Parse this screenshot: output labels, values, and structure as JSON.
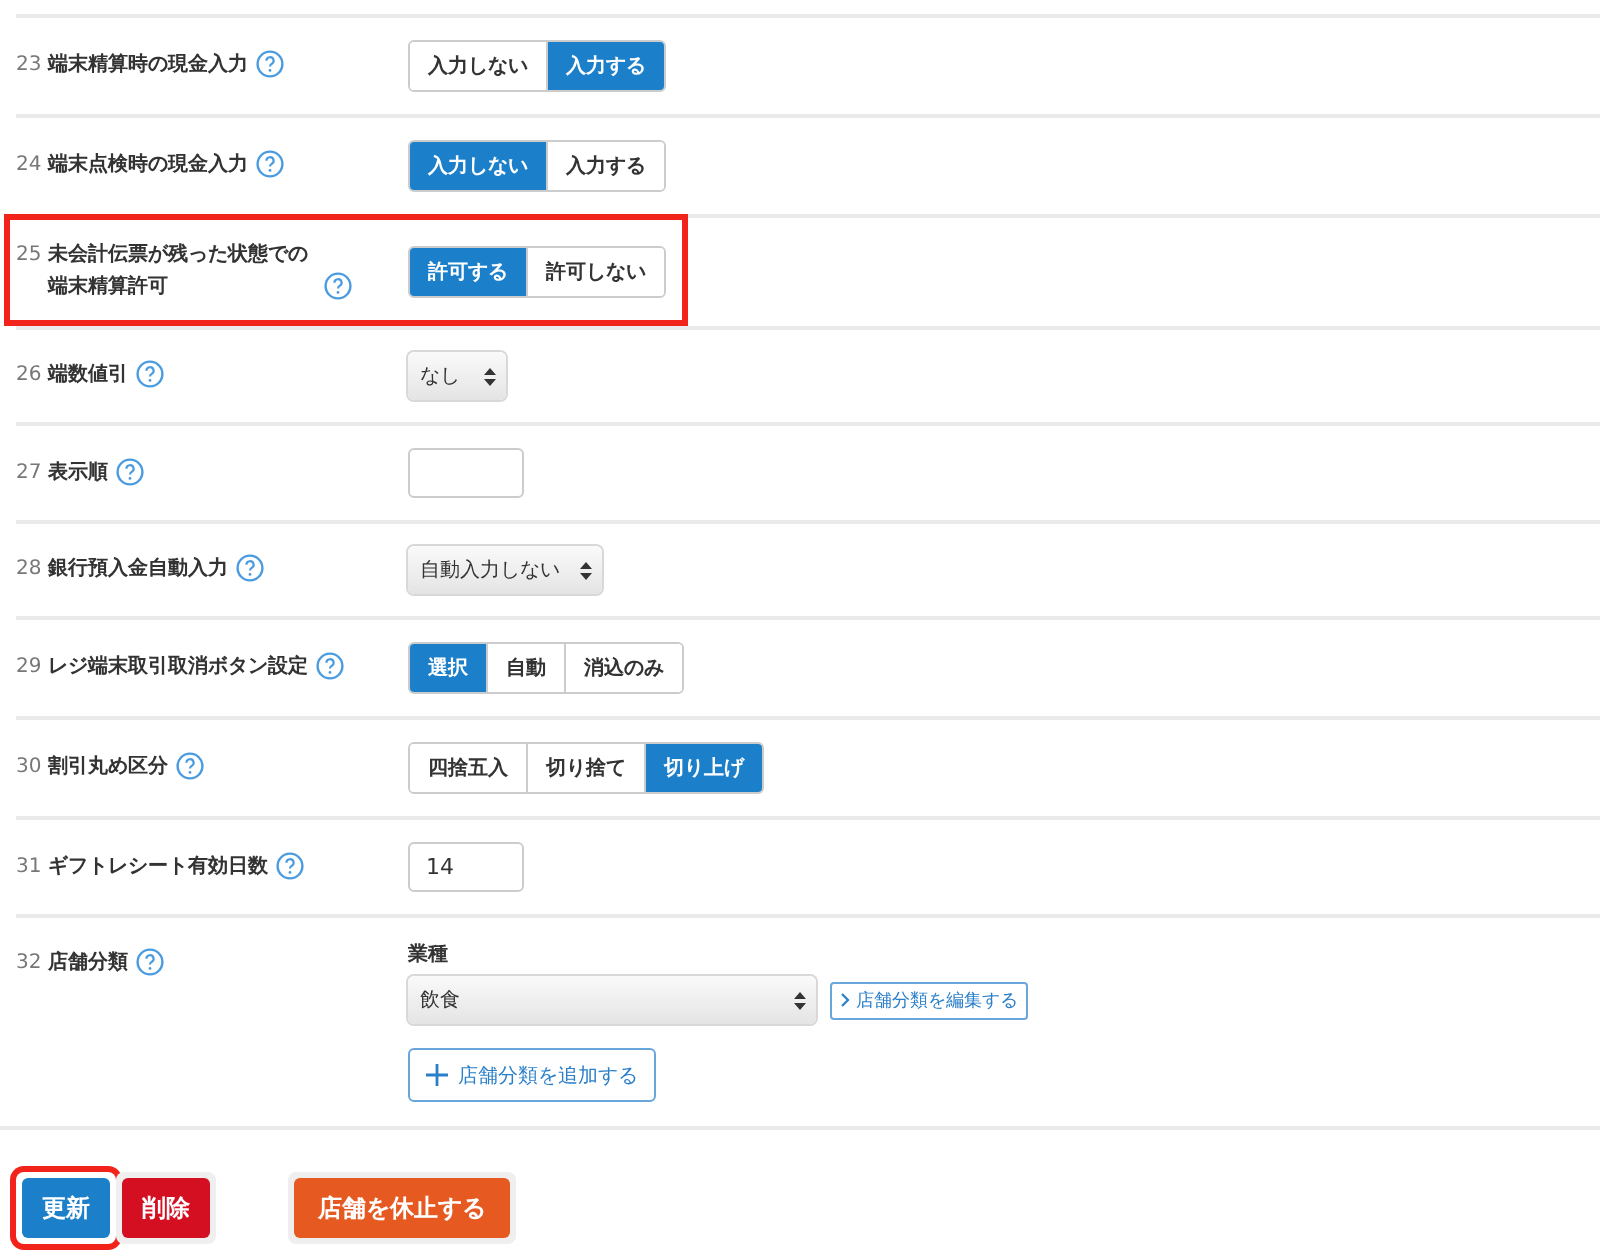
{
  "rows": [
    {
      "number": "23",
      "label": "端末精算時の現金入力",
      "kind": "toggle",
      "highlighted": false,
      "options": [
        {
          "label": "入力しない",
          "selected": false
        },
        {
          "label": "入力する",
          "selected": true
        }
      ]
    },
    {
      "number": "24",
      "label": "端末点検時の現金入力",
      "kind": "toggle",
      "highlighted": false,
      "options": [
        {
          "label": "入力しない",
          "selected": true
        },
        {
          "label": "入力する",
          "selected": false
        }
      ]
    },
    {
      "number": "25",
      "label": "未会計伝票が残った状態での端末精算許可",
      "kind": "toggle",
      "highlighted": true,
      "options": [
        {
          "label": "許可する",
          "selected": true
        },
        {
          "label": "許可しない",
          "selected": false
        }
      ]
    },
    {
      "number": "26",
      "label": "端数値引",
      "kind": "select",
      "highlighted": false,
      "value": "なし"
    },
    {
      "number": "27",
      "label": "表示順",
      "kind": "input",
      "highlighted": false
    },
    {
      "number": "28",
      "label": "銀行預入金自動入力",
      "kind": "select",
      "highlighted": false,
      "value": "自動入力しない"
    },
    {
      "number": "29",
      "label": "レジ端末取引取消ボタン設定",
      "kind": "toggle",
      "highlighted": false,
      "options": [
        {
          "label": "選択",
          "selected": true
        },
        {
          "label": "自動",
          "selected": false
        },
        {
          "label": "消込のみ",
          "selected": false
        }
      ]
    },
    {
      "number": "30",
      "label": "割引丸め区分",
      "kind": "toggle",
      "highlighted": false,
      "options": [
        {
          "label": "四捨五入",
          "selected": false
        },
        {
          "label": "切り捨て",
          "selected": false
        },
        {
          "label": "切り上げ",
          "selected": true
        }
      ]
    },
    {
      "number": "31",
      "label": "ギフトレシート有効日数",
      "kind": "input",
      "highlighted": false,
      "value": "14"
    },
    {
      "number": "32",
      "label": "店舗分類",
      "kind": "category",
      "highlighted": false,
      "field_label": "業種",
      "value": "飲食",
      "edit_link": "店舗分類を編集する",
      "add_button": "店舗分類を追加する"
    }
  ],
  "actions": [
    {
      "label": "更新",
      "kind": "primary",
      "highlighted": true
    },
    {
      "label": "削除",
      "kind": "danger",
      "highlighted": false
    },
    {
      "label": "店舗を休止する",
      "kind": "warning",
      "highlighted": false
    }
  ]
}
